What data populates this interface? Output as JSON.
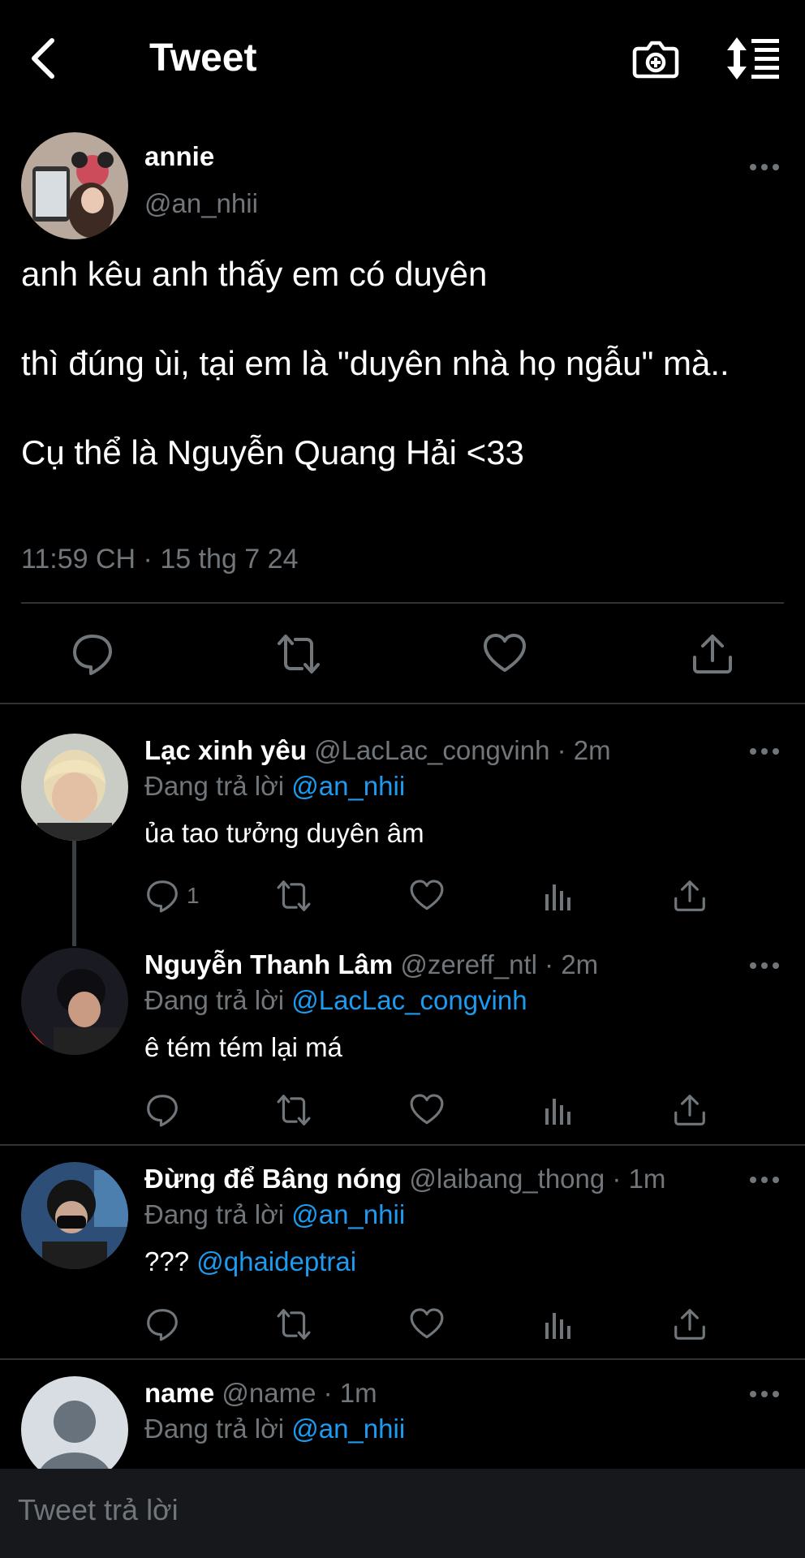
{
  "header": {
    "title": "Tweet"
  },
  "main_tweet": {
    "name": "annie",
    "handle": "@an_nhii",
    "text_lines": [
      "anh kêu anh thấy em có duyên",
      "thì đúng ùi, tại em là \"duyên nhà họ ngẫu\" mà..",
      "Cụ thể là Nguyễn Quang Hải <33"
    ],
    "timestamp": "11:59 CH · 15 thg 7 24"
  },
  "replies": [
    {
      "name": "Lạc xinh yêu",
      "meta": "@LacLac_congvinh · 2m",
      "replying_label": "Đang trả lời",
      "replying_to": "@an_nhii",
      "text": "ủa tao tưởng duyên âm",
      "reply_count": "1"
    },
    {
      "name": "Nguyễn Thanh Lâm",
      "meta": "@zereff_ntl · 2m",
      "replying_label": "Đang trả lời",
      "replying_to": "@LacLac_congvinh",
      "text": "ê tém tém lại má"
    },
    {
      "name": "Đừng để Bâng nóng",
      "meta": "@laibang_thong · 1m",
      "replying_label": "Đang trả lời",
      "replying_to": "@an_nhii",
      "text_prefix": "???",
      "text_mention": "@qhaideptrai"
    },
    {
      "name": "name",
      "meta": "@name · 1m",
      "replying_label": "Đang trả lời",
      "replying_to": "@an_nhii"
    }
  ],
  "compose": {
    "placeholder": "Tweet trả lời"
  },
  "colors": {
    "background": "#000000",
    "text": "#e7e9ea",
    "muted": "#71767b",
    "link": "#1d9bf0",
    "divider": "#2f3336"
  }
}
